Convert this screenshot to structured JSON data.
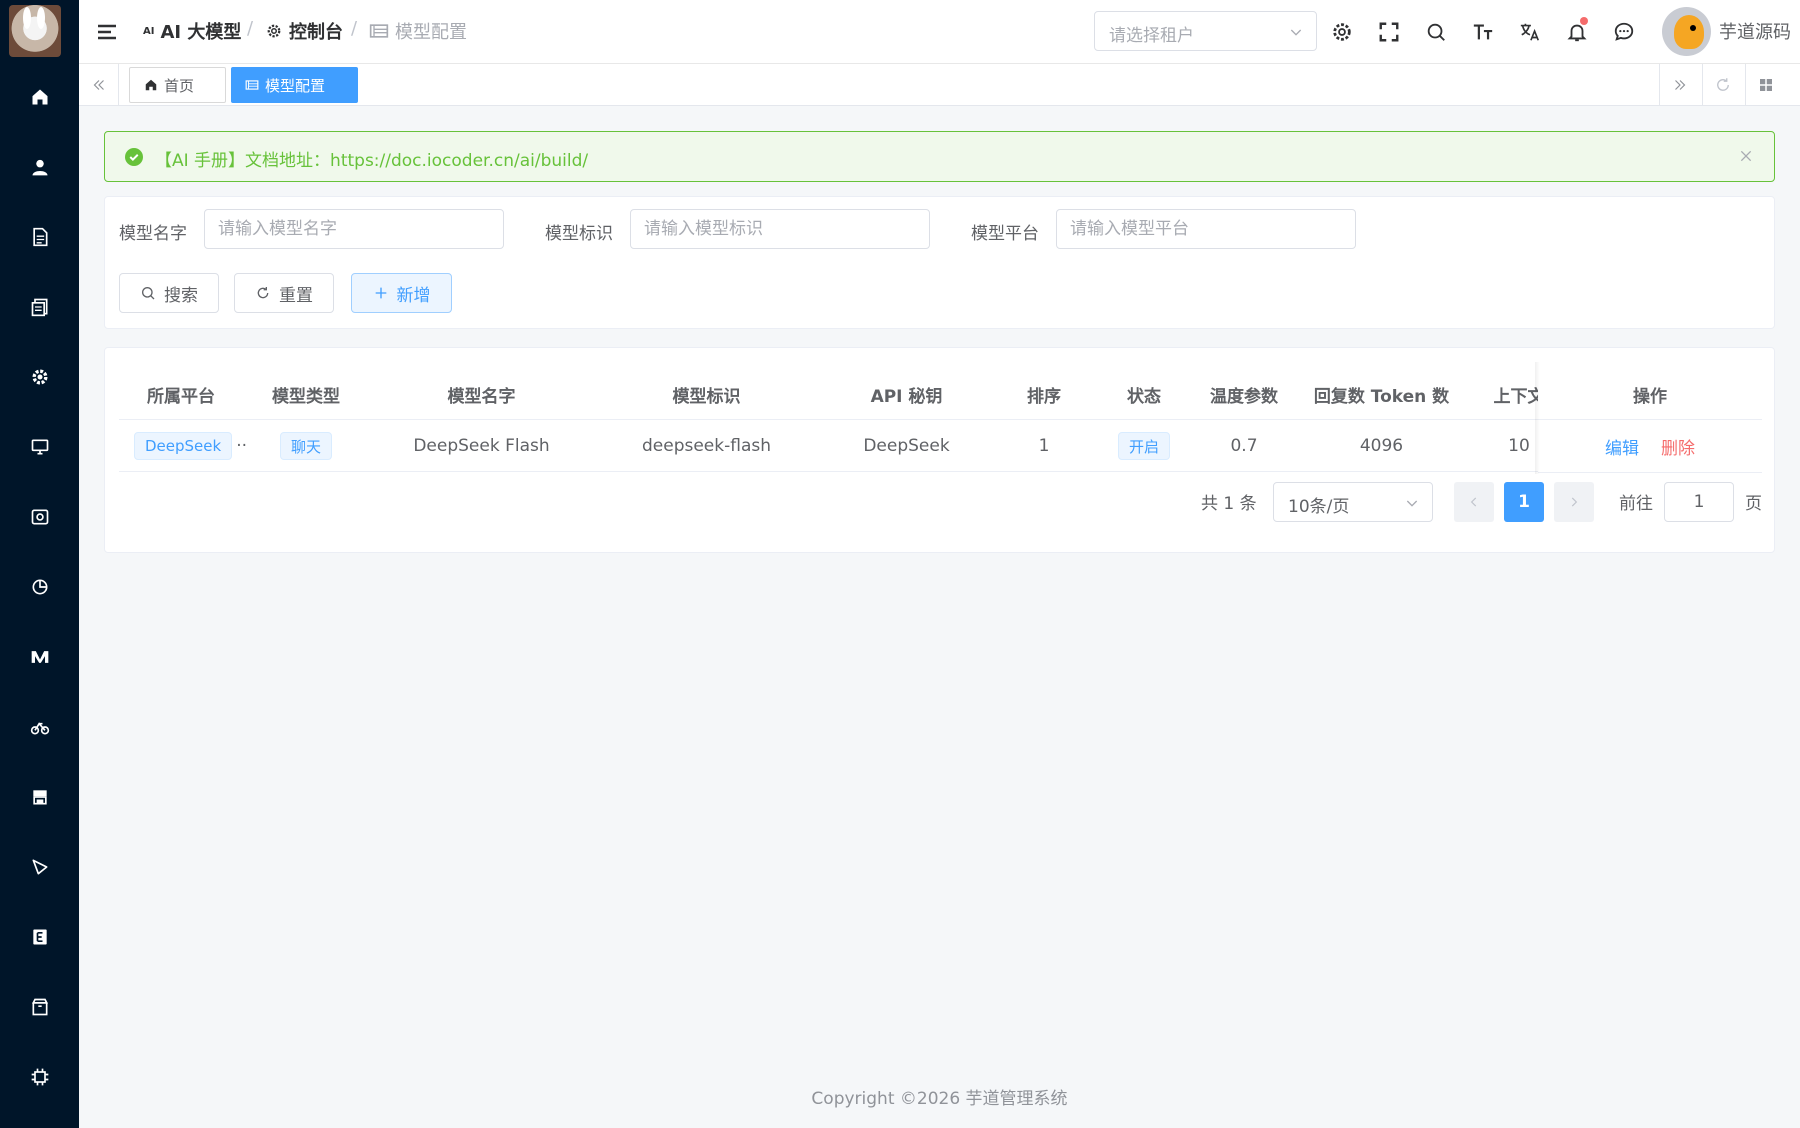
{
  "header": {
    "breadcrumb": [
      {
        "icon": "ai-icon",
        "label": "AI 大模型"
      },
      {
        "icon": "gear-icon",
        "label": "控制台"
      },
      {
        "icon": "model-config-icon",
        "label": "模型配置"
      }
    ],
    "tenant_placeholder": "请选择租户",
    "username": "芋道源码"
  },
  "tabs": [
    {
      "label": "首页",
      "icon": "home-icon"
    },
    {
      "label": "模型配置",
      "icon": "model-config-icon"
    }
  ],
  "alert": {
    "message": "【AI 手册】文档地址：https://doc.iocoder.cn/ai/build/",
    "color": "#67c23a"
  },
  "search": {
    "fields": [
      {
        "label": "模型名字",
        "placeholder": "请输入模型名字"
      },
      {
        "label": "模型标识",
        "placeholder": "请输入模型标识"
      },
      {
        "label": "模型平台",
        "placeholder": "请输入模型平台"
      }
    ],
    "buttons": {
      "search": "搜索",
      "reset": "重置",
      "add": "新增"
    }
  },
  "table": {
    "columns": [
      "所属平台",
      "模型类型",
      "模型名字",
      "模型标识",
      "API 秘钥",
      "排序",
      "状态",
      "温度参数",
      "回复数 Token 数",
      "上下文",
      "操作"
    ],
    "rows": [
      {
        "platform": "DeepSeek",
        "type": "聊天",
        "name": "DeepSeek Flash",
        "model": "deepseek-flash",
        "api_key": "DeepSeek",
        "sort": "1",
        "status": "开启",
        "temperature": "0.7",
        "max_tokens": "4096",
        "max_contexts": "10",
        "actions": {
          "edit": "编辑",
          "delete": "删除"
        }
      }
    ]
  },
  "pagination": {
    "total_text": "共 1 条",
    "page_size": "10条/页",
    "current_page": "1",
    "goto_label": "前往",
    "goto_value": "1",
    "page_suffix": "页"
  },
  "footer": "Copyright ©2026 芋道管理系统",
  "colors": {
    "primary": "#409eff",
    "success": "#67c23a",
    "danger": "#f56c6c",
    "sidebar": "#001529"
  }
}
